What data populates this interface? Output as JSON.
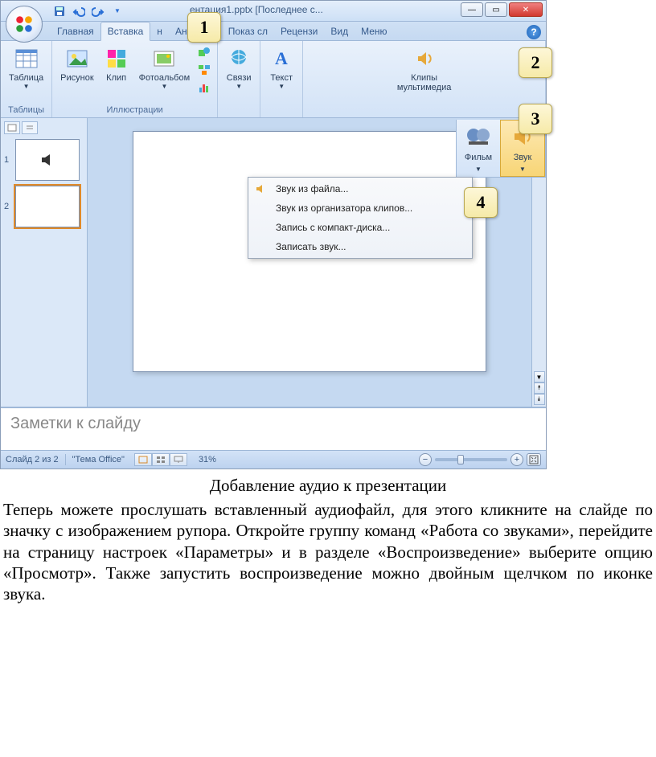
{
  "title": "ентация1.pptx [Последнее с...",
  "tabs": [
    "Главная",
    "Вставка",
    "н",
    "Анимаци",
    "Показ сл",
    "Рецензи",
    "Вид",
    "Меню"
  ],
  "active_tab": 1,
  "ribbon": {
    "groups": [
      {
        "label": "Таблицы",
        "items": [
          {
            "label": "Таблица",
            "dd": true
          }
        ]
      },
      {
        "label": "Иллюстрации",
        "items": [
          {
            "label": "Рисунок"
          },
          {
            "label": "Клип"
          },
          {
            "label": "Фотоальбом",
            "dd": true
          }
        ]
      },
      {
        "label": "",
        "items": [
          {
            "label": "Связи",
            "dd": true
          }
        ]
      },
      {
        "label": "",
        "items": [
          {
            "label": "Текст",
            "dd": true
          }
        ]
      },
      {
        "label": "",
        "items": [
          {
            "label": "Клипы\nмультимедиа",
            "dd": true
          }
        ]
      }
    ]
  },
  "media": {
    "film": "Фильм",
    "sound": "Звук"
  },
  "dropdown": {
    "items": [
      "Звук из файла...",
      "Звук из организатора клипов...",
      "Запись с компакт-диска...",
      "Записать звук..."
    ]
  },
  "thumbs": {
    "count": 2,
    "selected": 2
  },
  "notes_placeholder": "Заметки к слайду",
  "status": {
    "slide": "Слайд 2 из 2",
    "theme": "\"Тема Office\"",
    "zoom": "31%"
  },
  "badges": [
    "1",
    "2",
    "3",
    "4"
  ],
  "caption": "Добавление аудио к презентации",
  "body": "Теперь можете прослушать вставленный аудиофайл, для этого кликните на слайде по значку с изображением рупора. Откройте группу команд «Работа со звуками», перейдите на страницу настроек «Параметры» и в разделе «Воспроизведение» выберите опцию «Просмотр». Также запустить воспроизведение можно двойным щелчком по иконке звука."
}
